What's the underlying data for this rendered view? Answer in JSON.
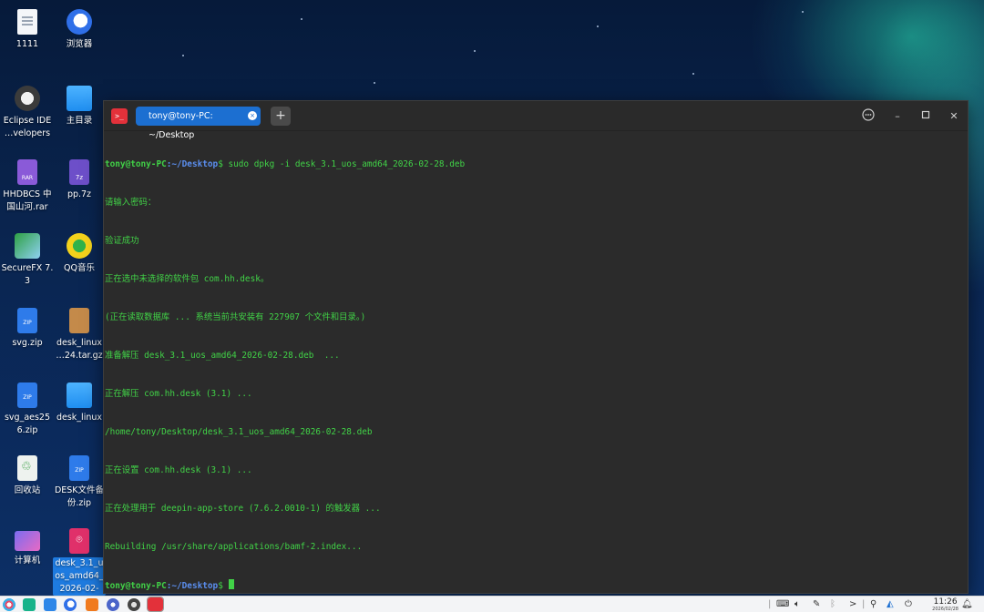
{
  "desktop": {
    "icons": [
      {
        "label": "1111"
      },
      {
        "label": "浏览器"
      },
      {
        "label": "Eclipse IDE …velopers"
      },
      {
        "label": "主目录"
      },
      {
        "label": "HHDBCS 中国山河.rar"
      },
      {
        "label": "pp.7z"
      },
      {
        "label": "SecureFX 7.3"
      },
      {
        "label": "QQ音乐"
      },
      {
        "label": "svg.zip"
      },
      {
        "label": "desk_linux …24.tar.gz"
      },
      {
        "label": "svg_aes256.zip"
      },
      {
        "label": "desk_linux"
      },
      {
        "label": "回收站"
      },
      {
        "label": "DESK文件备份.zip"
      },
      {
        "label": "计算机"
      },
      {
        "label": "desk_3.1_uos_amd64_2026-02-"
      }
    ],
    "file_badges": {
      "zip": "ZIP",
      "rar": "RAR",
      "sevenz": "7z"
    }
  },
  "terminal": {
    "tab_title": "tony@tony-PC: ~/Desktop",
    "new_tab_symbol": "+",
    "app_icon_symbol": ">_",
    "prompt_user": "tony@tony-PC",
    "prompt_path": ":~/Desktop",
    "prompt_symbol": "$",
    "command": " sudo dpkg -i desk_3.1_uos_amd64_2026-02-28.deb",
    "output": [
      "请输入密码：",
      "验证成功",
      "正在选中未选择的软件包 com.hh.desk。",
      "(正在读取数据库 ... 系统当前共安装有 227907 个文件和目录。)",
      "准备解压 desk_3.1_uos_amd64_2026-02-28.deb  ...",
      "正在解压 com.hh.desk (3.1) ...",
      "/home/tony/Desktop/desk_3.1_uos_amd64_2026-02-28.deb",
      "正在设置 com.hh.desk (3.1) ...",
      "正在处理用于 deepin-app-store (7.6.2.0010-1) 的触发器 ...",
      "Rebuilding /usr/share/applications/bamf-2.index..."
    ]
  },
  "taskbar": {
    "time": "11:26",
    "date": "2026/02/28",
    "expand_symbol": ">"
  }
}
